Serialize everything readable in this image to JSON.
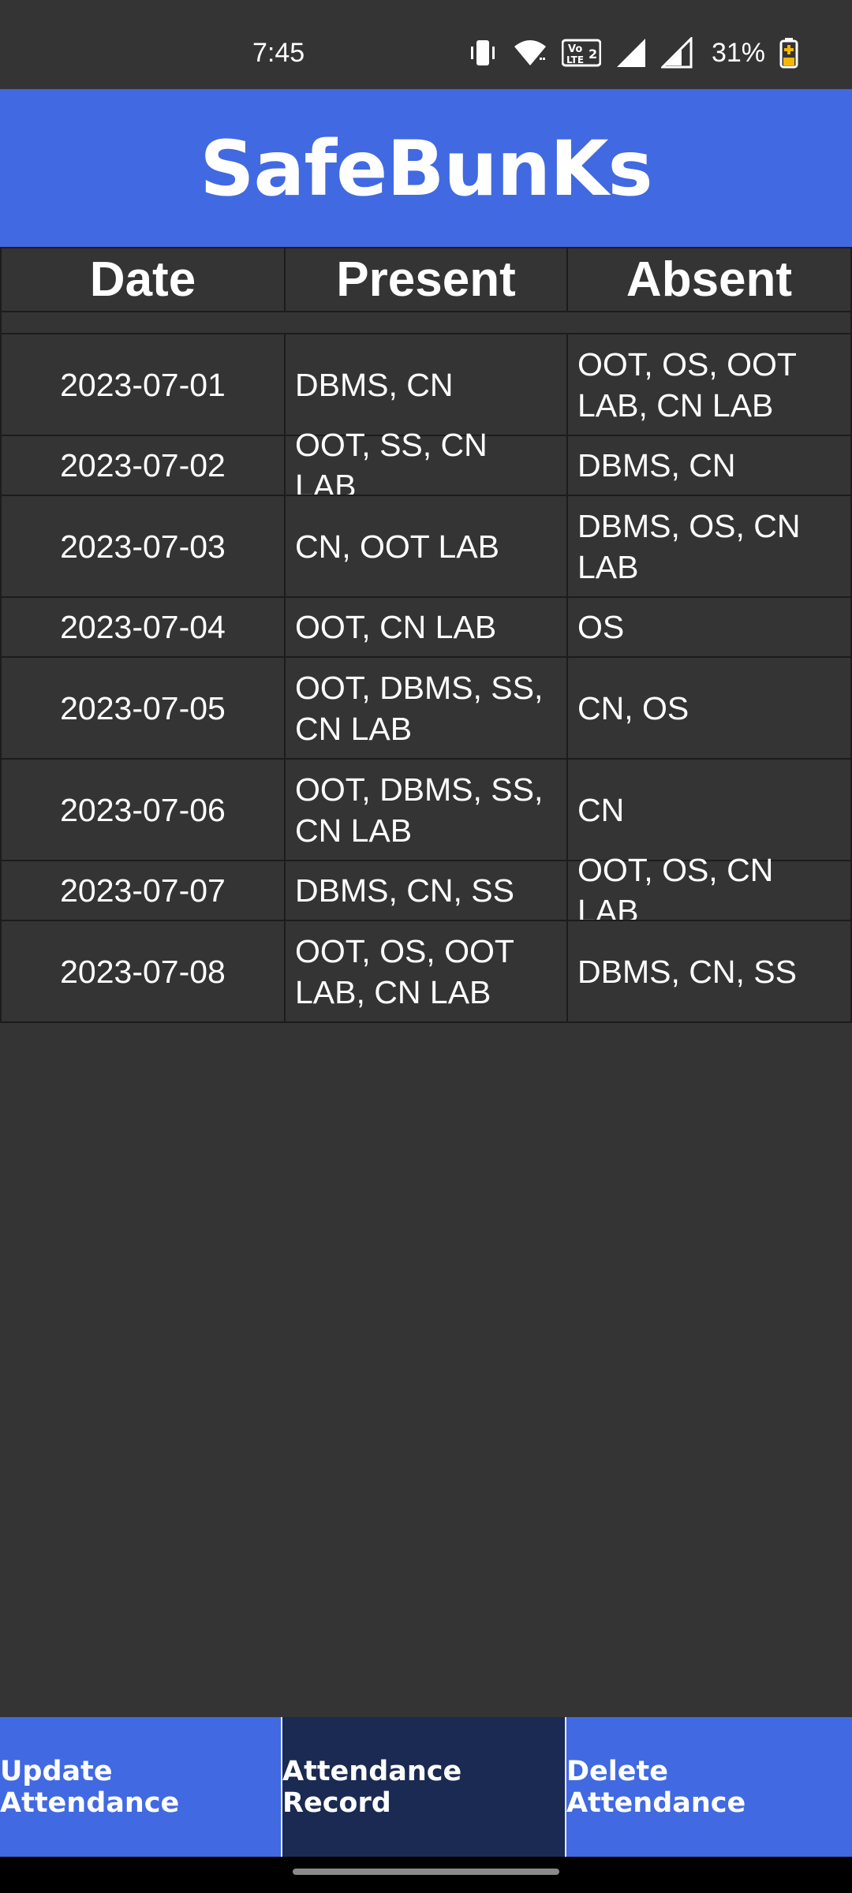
{
  "status_bar": {
    "time": "7:45",
    "network_label": "Vo LTE2",
    "battery": "31%",
    "icons": [
      "vibrate-icon",
      "wifi-icon",
      "volte-icon",
      "signal-icon",
      "signal-icon",
      "battery-icon"
    ]
  },
  "header": {
    "title": "SafeBunKs",
    "background": "#4169e1"
  },
  "table": {
    "columns": [
      "Date",
      "Present",
      "Absent"
    ],
    "rows": [
      {
        "date": "2023-07-01",
        "present": "DBMS, CN",
        "absent": "OOT, OS, OOT LAB, CN LAB"
      },
      {
        "date": "2023-07-02",
        "present": "OOT, SS, CN LAB",
        "absent": "DBMS, CN"
      },
      {
        "date": "2023-07-03",
        "present": "CN, OOT LAB",
        "absent": "DBMS, OS, CN LAB"
      },
      {
        "date": "2023-07-04",
        "present": "OOT, CN LAB",
        "absent": "OS"
      },
      {
        "date": "2023-07-05",
        "present": "OOT, DBMS, SS, CN LAB",
        "absent": "CN, OS"
      },
      {
        "date": "2023-07-06",
        "present": "OOT, DBMS, SS, CN LAB",
        "absent": "CN"
      },
      {
        "date": "2023-07-07",
        "present": "DBMS, CN, SS",
        "absent": "OOT, OS, CN LAB"
      },
      {
        "date": "2023-07-08",
        "present": "OOT, OS, OOT LAB, CN LAB",
        "absent": "DBMS, CN, SS"
      }
    ]
  },
  "bottom_nav": {
    "items": [
      {
        "label": "Update Attendance",
        "active": false
      },
      {
        "label": "Attendance Record",
        "active": true
      },
      {
        "label": "Delete Attendance",
        "active": false
      }
    ],
    "accent": "#4169e1",
    "active_color": "#1a2a52"
  }
}
